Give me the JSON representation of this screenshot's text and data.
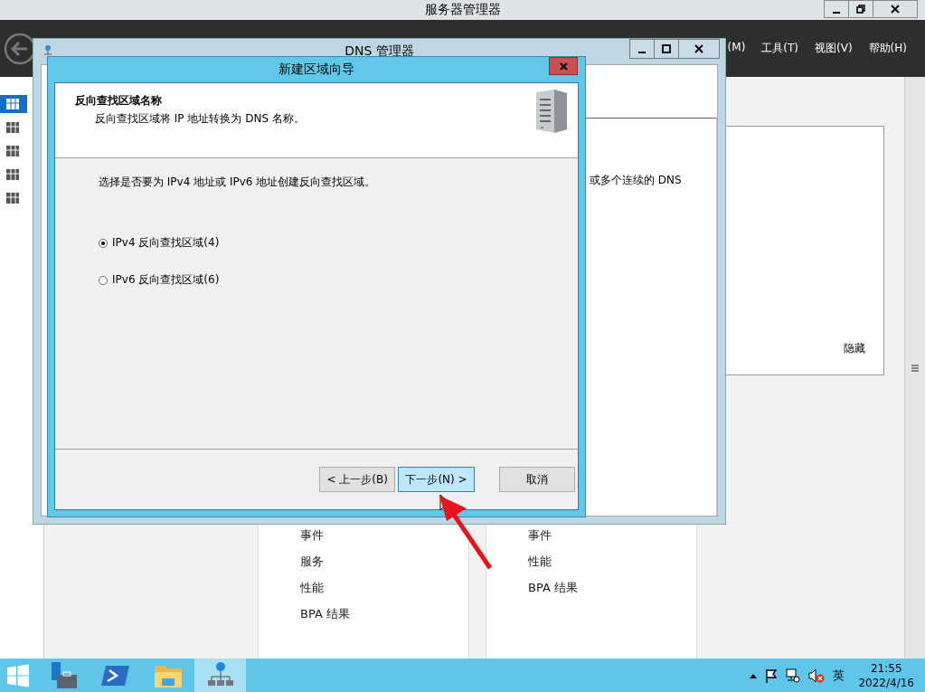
{
  "server_manager": {
    "title": "服务器管理器",
    "menu": [
      {
        "label": "(M)"
      },
      {
        "label": "工具(T)"
      },
      {
        "label": "视图(V)"
      },
      {
        "label": "帮助(H)"
      }
    ],
    "sidebar_items": [
      {
        "selected": true
      },
      {
        "selected": false
      },
      {
        "selected": false
      },
      {
        "selected": false
      },
      {
        "selected": false
      }
    ],
    "hide_label": "隐藏",
    "tiles": [
      {
        "links": [
          "事件",
          "服务",
          "性能",
          "BPA 结果"
        ]
      },
      {
        "links": [
          "事件",
          "性能",
          "BPA 结果"
        ]
      }
    ]
  },
  "dns_manager": {
    "title": "DNS 管理器",
    "text": "或多个连续的 DNS"
  },
  "wizard": {
    "title": "新建区域向导",
    "heading": "反向查找区域名称",
    "subheading": "反向查找区域将 IP 地址转换为 DNS 名称。",
    "prompt": "选择是否要为 IPv4 地址或 IPv6 地址创建反向查找区域。",
    "options": [
      {
        "label": "IPv4 反向查找区域(4)",
        "selected": true
      },
      {
        "label": "IPv6 反向查找区域(6)",
        "selected": false
      }
    ],
    "buttons": [
      {
        "label": "< 上一步(B)",
        "hovered": false
      },
      {
        "label": "下一步(N) >",
        "hovered": true
      },
      {
        "label": "取消",
        "hovered": false
      }
    ]
  },
  "taskbar": {
    "apps": [
      {
        "selected": false
      },
      {
        "selected": false
      },
      {
        "selected": false
      },
      {
        "selected": true
      }
    ],
    "ime": "英",
    "time": "21:55",
    "date": "2022/4/16"
  }
}
